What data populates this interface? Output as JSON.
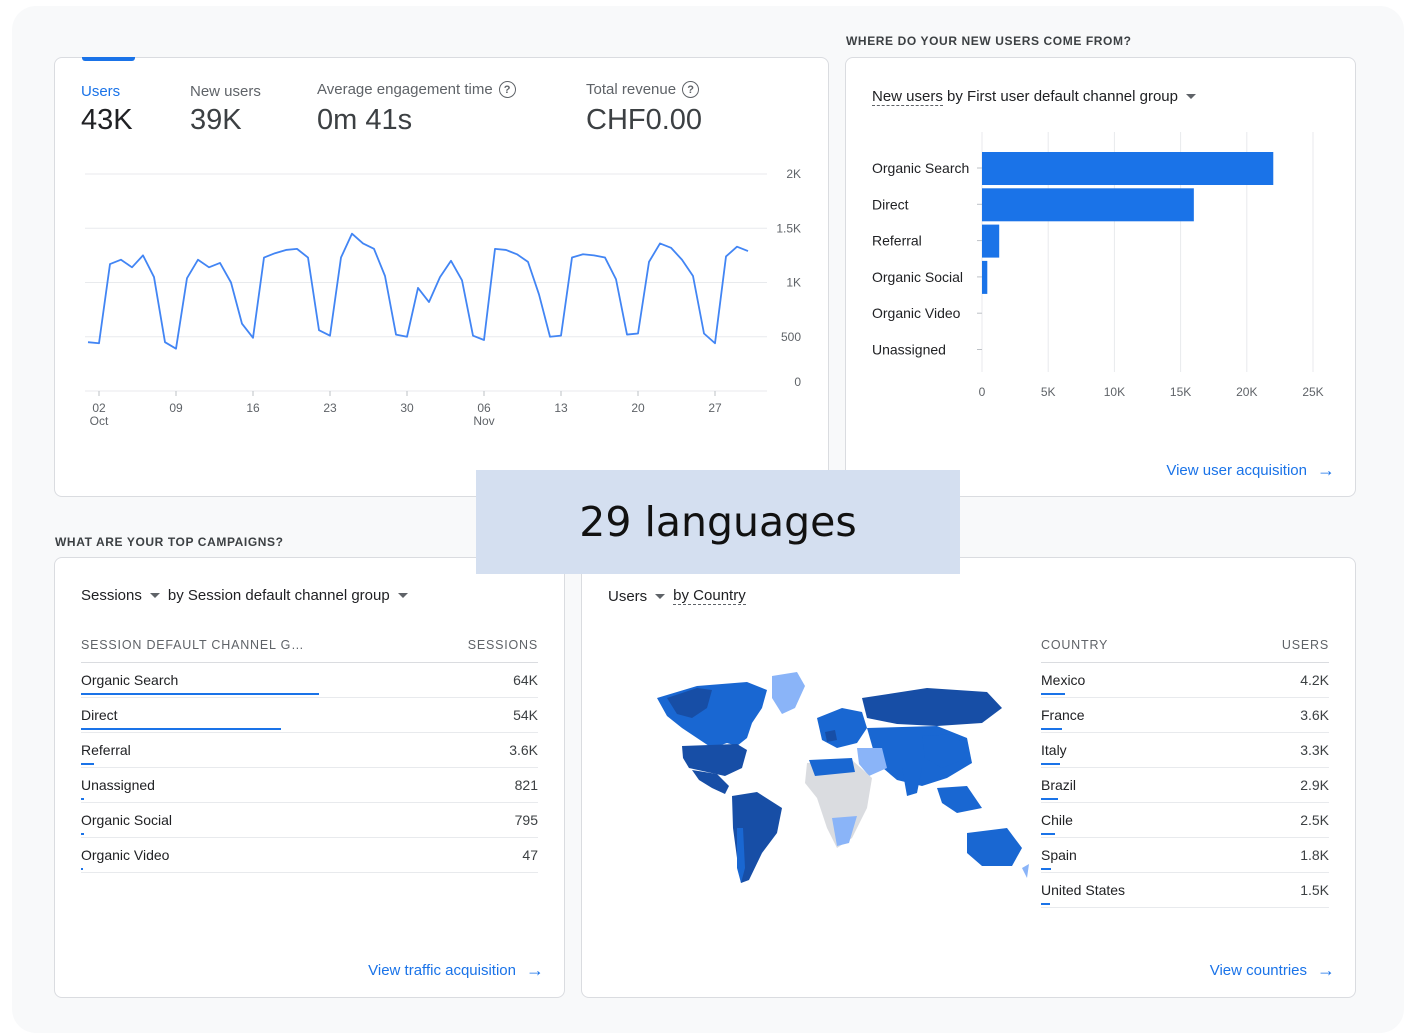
{
  "overview": {
    "metrics": [
      {
        "label": "Users",
        "value": "43K"
      },
      {
        "label": "New users",
        "value": "39K"
      },
      {
        "label": "Average engagement time",
        "value": "0m 41s"
      },
      {
        "label": "Total revenue",
        "value": "CHF0.00"
      }
    ],
    "help_glyph": "?"
  },
  "chart_data": [
    {
      "type": "line",
      "series": [
        {
          "values": [
            450,
            440,
            1170,
            1210,
            1140,
            1250,
            1050,
            450,
            390,
            1040,
            1210,
            1140,
            1180,
            1000,
            620,
            490,
            1230,
            1270,
            1300,
            1310,
            1230,
            560,
            510,
            1230,
            1450,
            1360,
            1310,
            1060,
            520,
            500,
            950,
            820,
            1050,
            1200,
            1020,
            510,
            470,
            1310,
            1300,
            1260,
            1190,
            890,
            500,
            510,
            1230,
            1260,
            1250,
            1230,
            1030,
            520,
            530,
            1190,
            1360,
            1320,
            1210,
            1060,
            530,
            440,
            1240,
            1330,
            1290
          ]
        }
      ],
      "x_tick_labels": [
        {
          "day": "02",
          "month": "Oct"
        },
        {
          "day": "09",
          "month": ""
        },
        {
          "day": "16",
          "month": ""
        },
        {
          "day": "23",
          "month": ""
        },
        {
          "day": "30",
          "month": ""
        },
        {
          "day": "06",
          "month": "Nov"
        },
        {
          "day": "13",
          "month": ""
        },
        {
          "day": "20",
          "month": ""
        },
        {
          "day": "27",
          "month": ""
        }
      ],
      "y_tick_labels": [
        "0",
        "500",
        "1K",
        "1.5K",
        "2K"
      ],
      "ylim": [
        0,
        2000
      ],
      "grid": true
    },
    {
      "type": "bar",
      "orientation": "horizontal",
      "categories": [
        "Organic Search",
        "Direct",
        "Referral",
        "Organic Social",
        "Organic Video",
        "Unassigned"
      ],
      "values": [
        22000,
        16000,
        1300,
        400,
        0,
        0
      ],
      "x_tick_labels": [
        "0",
        "5K",
        "10K",
        "15K",
        "20K",
        "25K"
      ],
      "xlim": [
        0,
        25000
      ],
      "grid": true
    }
  ],
  "acquisition": {
    "section_title": "WHERE DO YOUR NEW USERS COME FROM?",
    "selector_metric": "New users",
    "selector_rest": " by First user default channel group",
    "link": "View user acquisition"
  },
  "campaigns": {
    "section_title": "WHAT ARE YOUR TOP CAMPAIGNS?",
    "selector_metric": "Sessions",
    "selector_dimension": "by Session default channel group",
    "col_name": "SESSION DEFAULT CHANNEL G…",
    "col_value": "SESSIONS",
    "rows": [
      {
        "name": "Organic Search",
        "value": "64K",
        "share": 1.0
      },
      {
        "name": "Direct",
        "value": "54K",
        "share": 0.84
      },
      {
        "name": "Referral",
        "value": "3.6K",
        "share": 0.056
      },
      {
        "name": "Unassigned",
        "value": "821",
        "share": 0.013
      },
      {
        "name": "Organic Social",
        "value": "795",
        "share": 0.012
      },
      {
        "name": "Organic Video",
        "value": "47",
        "share": 0.001
      }
    ],
    "link": "View traffic acquisition"
  },
  "countries": {
    "selector_metric": "Users",
    "selector_dimension": "by Country",
    "col_name": "COUNTRY",
    "col_value": "USERS",
    "rows": [
      {
        "name": "Mexico",
        "value": "4.2K",
        "share": 1.0
      },
      {
        "name": "France",
        "value": "3.6K",
        "share": 0.86
      },
      {
        "name": "Italy",
        "value": "3.3K",
        "share": 0.79
      },
      {
        "name": "Brazil",
        "value": "2.9K",
        "share": 0.69
      },
      {
        "name": "Chile",
        "value": "2.5K",
        "share": 0.6
      },
      {
        "name": "Spain",
        "value": "1.8K",
        "share": 0.43
      },
      {
        "name": "United States",
        "value": "1.5K",
        "share": 0.36
      }
    ],
    "link": "View countries"
  },
  "overlay_text": "29 languages",
  "colors": {
    "accent": "#1a73e8",
    "map_dark": "#174ea6",
    "map_mid": "#1967d2",
    "map_light": "#8ab4f8",
    "map_none": "#dadce0"
  },
  "icons": {
    "arrow": "→"
  }
}
